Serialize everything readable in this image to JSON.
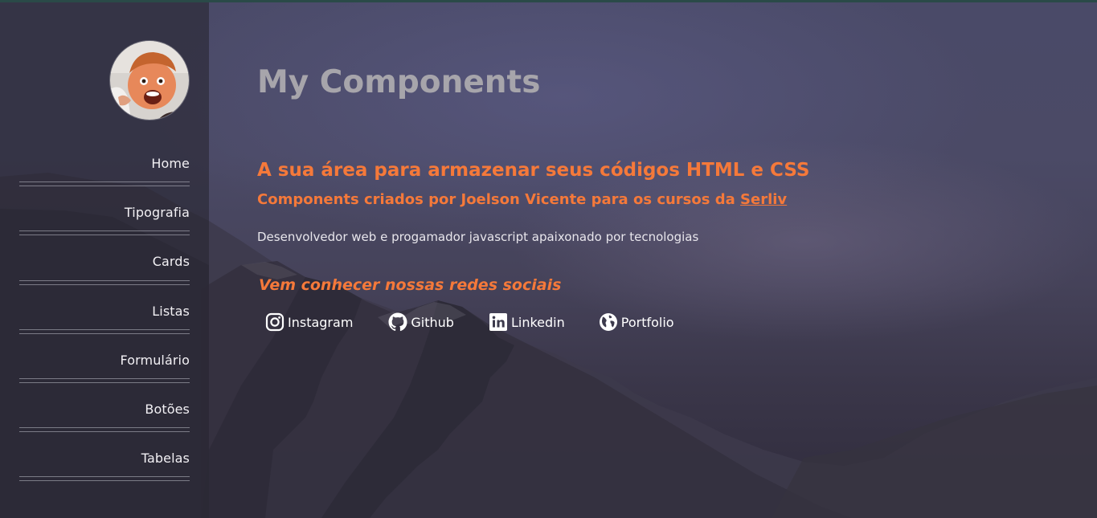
{
  "sidebar": {
    "items": [
      {
        "label": "Home"
      },
      {
        "label": "Tipografia"
      },
      {
        "label": "Cards"
      },
      {
        "label": "Listas"
      },
      {
        "label": "Formulário"
      },
      {
        "label": "Botões"
      },
      {
        "label": "Tabelas"
      }
    ]
  },
  "main": {
    "title": "My Components",
    "headline": "A sua área para armazenar seus códigos HTML e CSS",
    "subheadline_text": "Components criados por Joelson Vicente para os cursos da ",
    "subheadline_link": "Serliv",
    "description": "Desenvolvedor web e progamador javascript apaixonado por tecnologias",
    "social_title": "Vem conhecer nossas redes sociais",
    "socials": [
      {
        "label": "Instagram",
        "icon": "instagram-icon"
      },
      {
        "label": "Github",
        "icon": "github-icon"
      },
      {
        "label": "Linkedin",
        "icon": "linkedin-icon"
      },
      {
        "label": "Portfolio",
        "icon": "globe-icon"
      }
    ]
  },
  "colors": {
    "accent": "#f5793a",
    "title": "#a7a5ab",
    "text": "#e8e6ec",
    "sidebar_bg": "#282632"
  }
}
